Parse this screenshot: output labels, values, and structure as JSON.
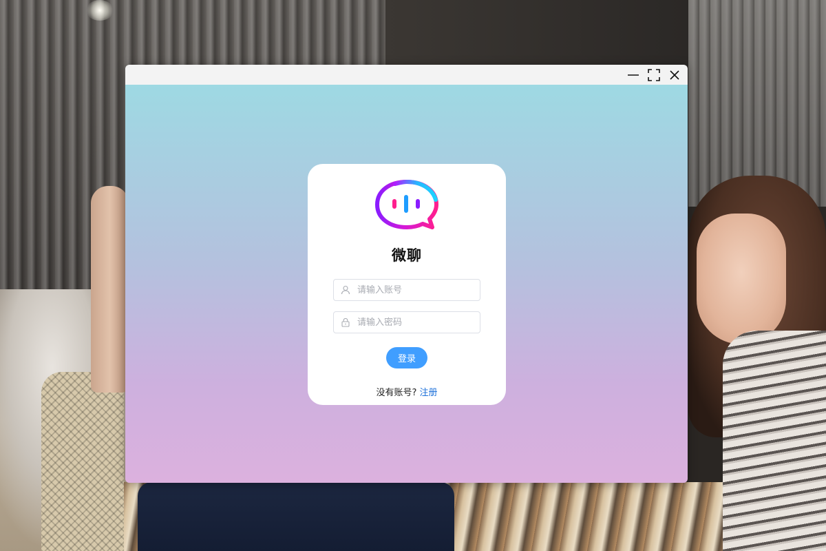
{
  "window": {
    "controls": {
      "minimize_icon": "minimize-icon",
      "maximize_icon": "fullscreen-icon",
      "close_icon": "close-icon"
    }
  },
  "login": {
    "title": "微聊",
    "account": {
      "placeholder": "请输入账号",
      "value": "",
      "icon": "user-icon"
    },
    "password": {
      "placeholder": "请输入密码",
      "value": "",
      "icon": "lock-icon"
    },
    "login_button": "登录",
    "register_prompt": "没有账号?",
    "register_link": "注册"
  },
  "colors": {
    "accent": "#409eff",
    "link": "#1a6fd9",
    "gradient_top": "#9ed9e3",
    "gradient_bottom": "#dcb1de"
  }
}
